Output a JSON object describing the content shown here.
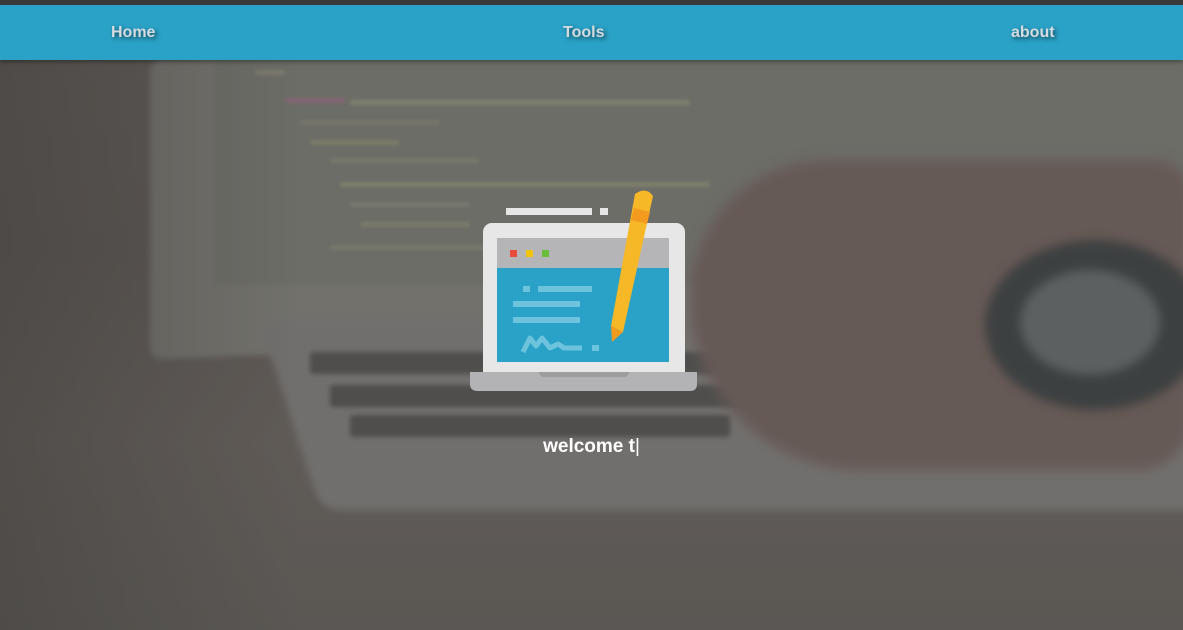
{
  "nav": {
    "home_label": "Home",
    "tools_label": "Tools",
    "about_label": "about",
    "bar_color": "#2aa1c6"
  },
  "hero": {
    "icon": "laptop-with-pencil-icon",
    "welcome_text": "welcome t",
    "caret": "|"
  },
  "background": {
    "description_icon": "laptop-keyboard-photo"
  }
}
